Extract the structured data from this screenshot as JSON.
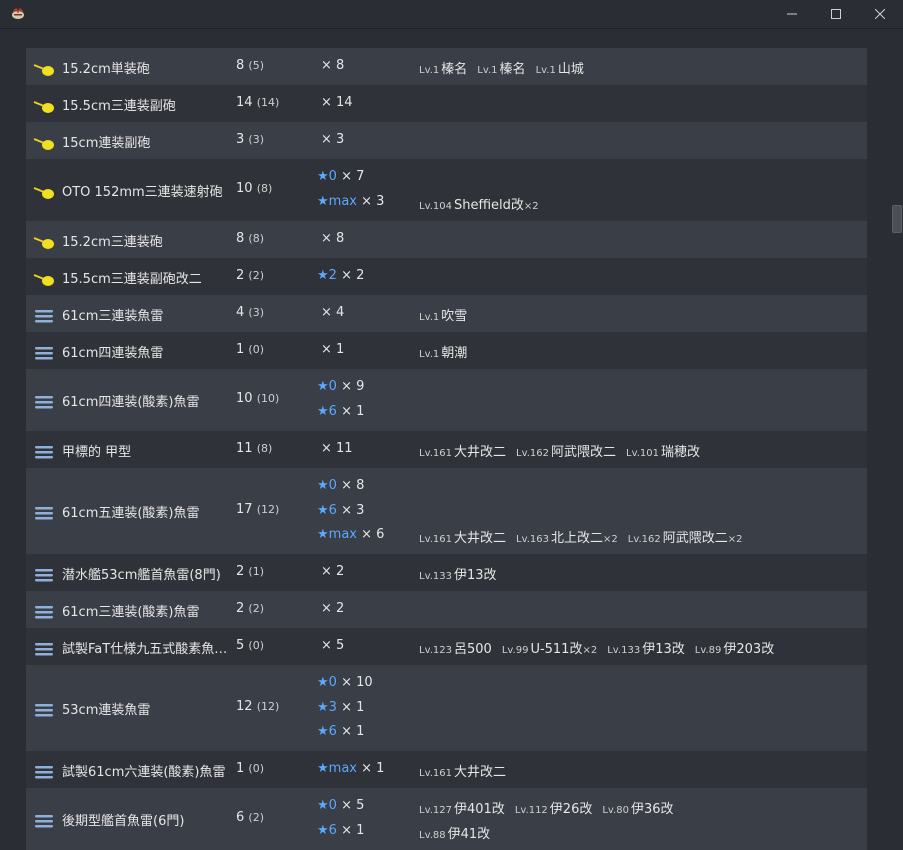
{
  "window": {
    "icon": "app-logo-icon",
    "controls": [
      "minimize-icon",
      "maximize-icon",
      "close-icon"
    ]
  },
  "colors": {
    "star": "#5aa8ff",
    "rowDark": "#3a3e46",
    "rowLight": "#2f3238"
  },
  "rows": [
    {
      "icon": "gun-yellow-icon",
      "name": "15.2cm単装砲",
      "count": "8",
      "held": "(5)",
      "stars": [
        {
          "star": "",
          "mult": "× 8"
        }
      ],
      "ships": [
        {
          "lv": "Lv.1",
          "name": "榛名"
        },
        {
          "lv": "Lv.1",
          "name": "榛名"
        },
        {
          "lv": "Lv.1",
          "name": "山城"
        }
      ]
    },
    {
      "icon": "gun-yellow-icon",
      "name": "15.5cm三連装副砲",
      "count": "14",
      "held": "(14)",
      "stars": [
        {
          "star": "",
          "mult": "× 14"
        }
      ],
      "ships": []
    },
    {
      "icon": "gun-yellow-icon",
      "name": "15cm連装副砲",
      "count": "3",
      "held": "(3)",
      "stars": [
        {
          "star": "",
          "mult": "× 3"
        }
      ],
      "ships": []
    },
    {
      "icon": "gun-yellow-icon",
      "name": "OTO 152mm三連装速射砲",
      "count": "10",
      "held": "(8)",
      "stars": [
        {
          "star": "★0",
          "mult": "× 7"
        },
        {
          "star": "★max",
          "mult": "× 3"
        }
      ],
      "ships": [
        {
          "lv": "Lv.104",
          "name": "Sheffield改",
          "mult": "×2"
        }
      ]
    },
    {
      "icon": "gun-yellow-icon",
      "name": "15.2cm三連装砲",
      "count": "8",
      "held": "(8)",
      "stars": [
        {
          "star": "",
          "mult": "× 8"
        }
      ],
      "ships": []
    },
    {
      "icon": "gun-yellow-icon",
      "name": "15.5cm三連装副砲改二",
      "count": "2",
      "held": "(2)",
      "stars": [
        {
          "star": "★2",
          "mult": "× 2"
        }
      ],
      "ships": []
    },
    {
      "icon": "torpedo-icon",
      "name": "61cm三連装魚雷",
      "count": "4",
      "held": "(3)",
      "stars": [
        {
          "star": "",
          "mult": "× 4"
        }
      ],
      "ships": [
        {
          "lv": "Lv.1",
          "name": "吹雪"
        }
      ]
    },
    {
      "icon": "torpedo-icon",
      "name": "61cm四連装魚雷",
      "count": "1",
      "held": "(0)",
      "stars": [
        {
          "star": "",
          "mult": "× 1"
        }
      ],
      "ships": [
        {
          "lv": "Lv.1",
          "name": "朝潮"
        }
      ]
    },
    {
      "icon": "torpedo-icon",
      "name": "61cm四連装(酸素)魚雷",
      "count": "10",
      "held": "(10)",
      "stars": [
        {
          "star": "★0",
          "mult": "× 9"
        },
        {
          "star": "★6",
          "mult": "× 1"
        }
      ],
      "ships": []
    },
    {
      "icon": "torpedo-icon",
      "name": "甲標的 甲型",
      "count": "11",
      "held": "(8)",
      "stars": [
        {
          "star": "",
          "mult": "× 11"
        }
      ],
      "ships": [
        {
          "lv": "Lv.161",
          "name": "大井改二"
        },
        {
          "lv": "Lv.162",
          "name": "阿武隈改二"
        },
        {
          "lv": "Lv.101",
          "name": "瑞穂改"
        }
      ]
    },
    {
      "icon": "torpedo-icon",
      "name": "61cm五連装(酸素)魚雷",
      "count": "17",
      "held": "(12)",
      "stars": [
        {
          "star": "★0",
          "mult": "× 8"
        },
        {
          "star": "★6",
          "mult": "× 3"
        },
        {
          "star": "★max",
          "mult": "× 6"
        }
      ],
      "ships": [
        {
          "lv": "Lv.161",
          "name": "大井改二"
        },
        {
          "lv": "Lv.163",
          "name": "北上改二",
          "mult": "×2"
        },
        {
          "lv": "Lv.162",
          "name": "阿武隈改二",
          "mult": "×2"
        }
      ]
    },
    {
      "icon": "torpedo-icon",
      "name": "潜水艦53cm艦首魚雷(8門)",
      "count": "2",
      "held": "(1)",
      "stars": [
        {
          "star": "",
          "mult": "× 2"
        }
      ],
      "ships": [
        {
          "lv": "Lv.133",
          "name": "伊13改"
        }
      ]
    },
    {
      "icon": "torpedo-icon",
      "name": "61cm三連装(酸素)魚雷",
      "count": "2",
      "held": "(2)",
      "stars": [
        {
          "star": "",
          "mult": "× 2"
        }
      ],
      "ships": []
    },
    {
      "icon": "torpedo-icon",
      "name": "試製FaT仕様九五式酸素魚…",
      "count": "5",
      "held": "(0)",
      "stars": [
        {
          "star": "",
          "mult": "× 5"
        }
      ],
      "ships": [
        {
          "lv": "Lv.123",
          "name": "呂500"
        },
        {
          "lv": "Lv.99",
          "name": "U-511改",
          "mult": "×2"
        },
        {
          "lv": "Lv.133",
          "name": "伊13改"
        },
        {
          "lv": "Lv.89",
          "name": "伊203改"
        }
      ]
    },
    {
      "icon": "torpedo-icon",
      "name": "53cm連装魚雷",
      "count": "12",
      "held": "(12)",
      "stars": [
        {
          "star": "★0",
          "mult": "× 10"
        },
        {
          "star": "★3",
          "mult": "× 1"
        },
        {
          "star": "★6",
          "mult": "× 1"
        }
      ],
      "ships": []
    },
    {
      "icon": "torpedo-icon",
      "name": "試製61cm六連装(酸素)魚雷",
      "count": "1",
      "held": "(0)",
      "stars": [
        {
          "star": "★max",
          "mult": "× 1"
        }
      ],
      "ships": [
        {
          "lv": "Lv.161",
          "name": "大井改二"
        }
      ]
    },
    {
      "icon": "torpedo-icon",
      "name": "後期型艦首魚雷(6門)",
      "count": "6",
      "held": "(2)",
      "stars": [
        {
          "star": "★0",
          "mult": "× 5"
        },
        {
          "star": "★6",
          "mult": "× 1"
        }
      ],
      "ships": [
        {
          "lv": "Lv.127",
          "name": "伊401改"
        },
        {
          "lv": "Lv.112",
          "name": "伊26改"
        },
        {
          "lv": "Lv.80",
          "name": "伊36改"
        },
        {
          "lv": "Lv.88",
          "name": "伊41改"
        }
      ]
    }
  ]
}
